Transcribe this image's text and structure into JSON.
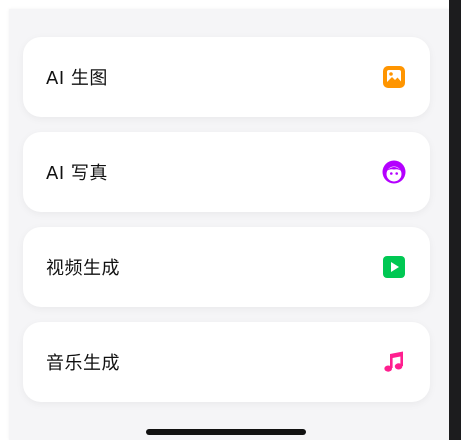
{
  "menu": {
    "items": [
      {
        "label": "AI 生图",
        "icon": "image-icon",
        "color": "#ff9500"
      },
      {
        "label": "AI 写真",
        "icon": "face-icon",
        "color": "#b400ff"
      },
      {
        "label": "视频生成",
        "icon": "play-icon",
        "color": "#00c853"
      },
      {
        "label": "音乐生成",
        "icon": "music-note-icon",
        "color": "#ff1f8f"
      }
    ]
  }
}
